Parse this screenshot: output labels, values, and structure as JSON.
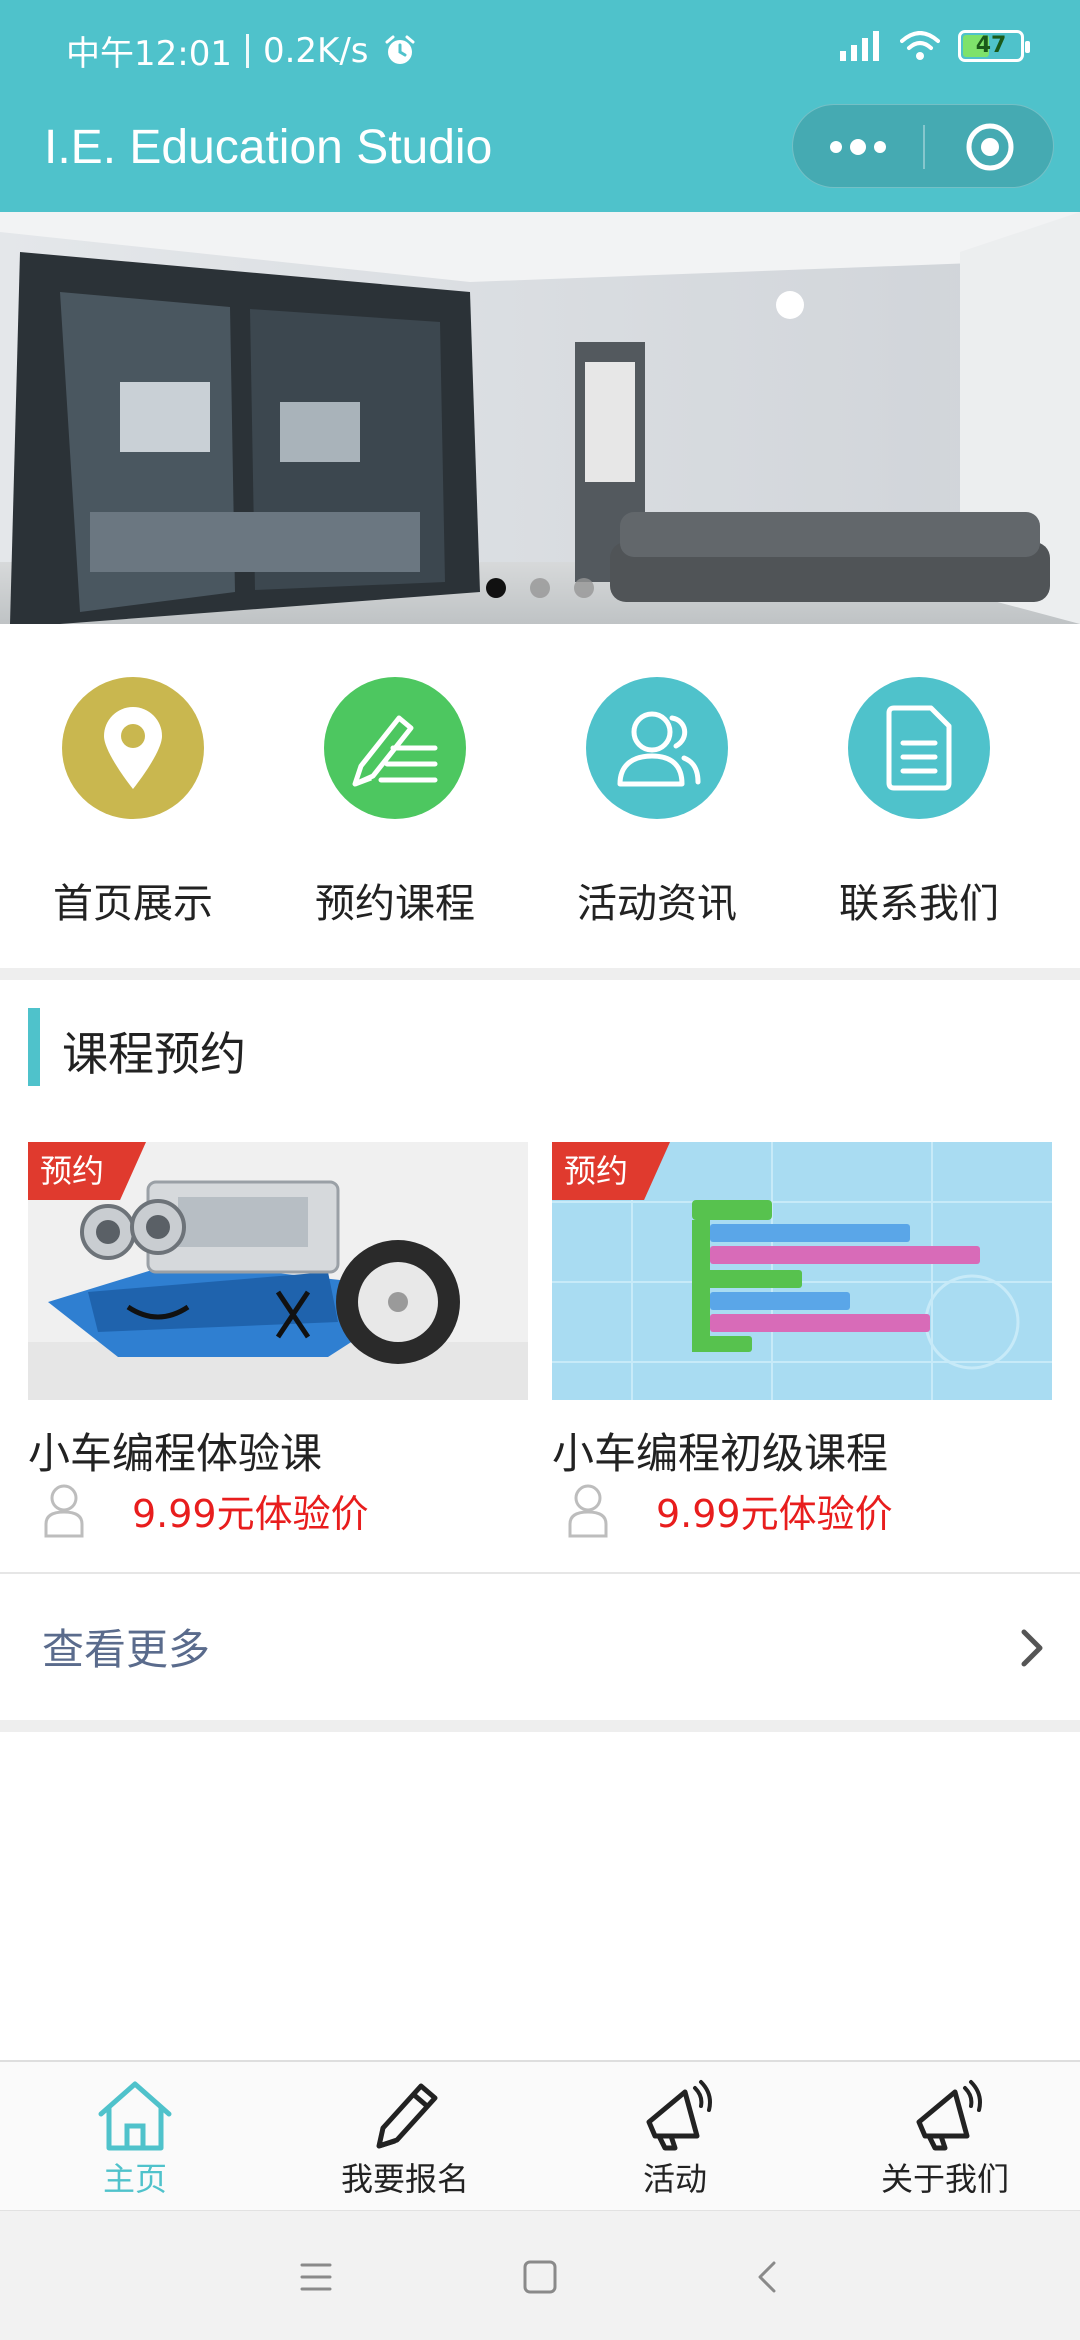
{
  "status_bar": {
    "time": "中午12:01",
    "net_speed": "0.2K/s",
    "battery": "47",
    "battery_level": 0.47
  },
  "header": {
    "title": "I.E. Education Studio",
    "more_icon": "more-dots-icon",
    "close_icon": "target-close-icon",
    "background_color": "#4fc2cb"
  },
  "banner": {
    "slide_count": 3,
    "active_slide": 1
  },
  "quick_nav": [
    {
      "label": "首页展示",
      "icon": "location-pin-icon",
      "color": "#c9b74f"
    },
    {
      "label": "预约课程",
      "icon": "edit-list-icon",
      "color": "#4dc760"
    },
    {
      "label": "活动资讯",
      "icon": "users-icon",
      "color": "#4fc2cb"
    },
    {
      "label": "联系我们",
      "icon": "document-icon",
      "color": "#4fc2cb"
    }
  ],
  "section": {
    "title": "课程预约",
    "accent_color": "#4fc2cb"
  },
  "courses": [
    {
      "tag": "预约",
      "name": "小车编程体验课",
      "price": "9.99元体验价"
    },
    {
      "tag": "预约",
      "name": "小车编程初级课程",
      "price": "9.99元体验价"
    }
  ],
  "more": {
    "label": "查看更多"
  },
  "tabbar": {
    "items": [
      {
        "label": "主页",
        "icon": "home-icon",
        "active": true
      },
      {
        "label": "我要报名",
        "icon": "pencil-icon",
        "active": false
      },
      {
        "label": "活动",
        "icon": "megaphone-icon",
        "active": false
      },
      {
        "label": "关于我们",
        "icon": "megaphone-icon",
        "active": false
      }
    ],
    "active_color": "#4fc2cb"
  },
  "system_nav": {
    "icons": [
      "menu-icon",
      "home-square-icon",
      "back-icon"
    ]
  }
}
